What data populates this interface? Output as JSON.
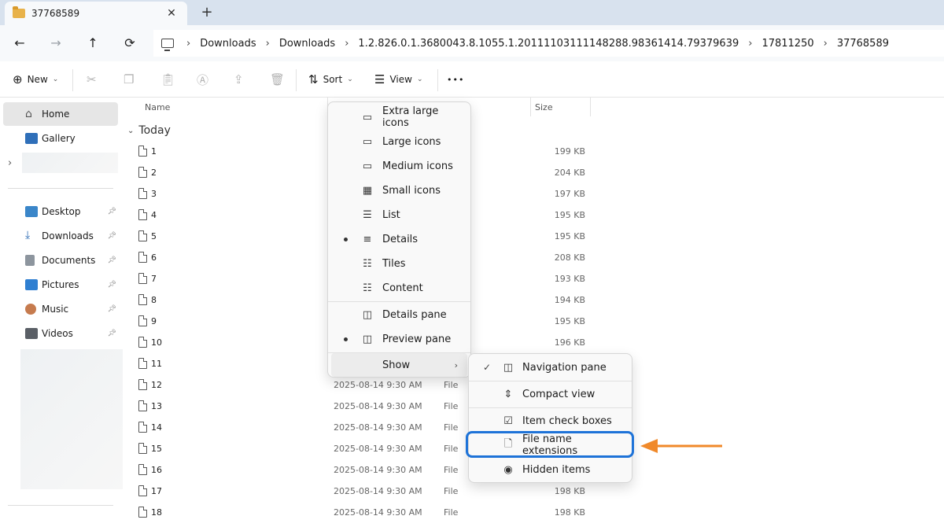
{
  "tab": {
    "title": "37768589",
    "close": "✕",
    "new": "+"
  },
  "nav": {
    "back": "←",
    "forward": "→",
    "up": "↑",
    "refresh": "⟳"
  },
  "breadcrumb": [
    "Downloads",
    "Downloads",
    "1.2.826.0.1.3680043.8.1055.1.20111103111148288.98361414.79379639",
    "17811250",
    "37768589"
  ],
  "breadcrumb_sep": "›",
  "toolbar": {
    "new_label": "New",
    "sort_label": "Sort",
    "view_label": "View",
    "more": "•••"
  },
  "sidebar": {
    "home": "Home",
    "gallery": "Gallery",
    "expand": "›",
    "pinned": [
      "Desktop",
      "Downloads",
      "Documents",
      "Pictures",
      "Music",
      "Videos"
    ]
  },
  "columns": {
    "name": "Name",
    "size": "Size"
  },
  "group": {
    "label": "Today"
  },
  "files": [
    {
      "name": "1",
      "date": "",
      "type": "",
      "size": "199 KB"
    },
    {
      "name": "2",
      "date": "",
      "type": "",
      "size": "204 KB"
    },
    {
      "name": "3",
      "date": "",
      "type": "",
      "size": "197 KB"
    },
    {
      "name": "4",
      "date": "",
      "type": "",
      "size": "195 KB"
    },
    {
      "name": "5",
      "date": "",
      "type": "",
      "size": "195 KB"
    },
    {
      "name": "6",
      "date": "",
      "type": "",
      "size": "208 KB"
    },
    {
      "name": "7",
      "date": "",
      "type": "",
      "size": "193 KB"
    },
    {
      "name": "8",
      "date": "",
      "type": "",
      "size": "194 KB"
    },
    {
      "name": "9",
      "date": "",
      "type": "",
      "size": "195 KB"
    },
    {
      "name": "10",
      "date": "",
      "type": "",
      "size": "196 KB"
    },
    {
      "name": "11",
      "date": "",
      "type": "",
      "size": ""
    },
    {
      "name": "12",
      "date": "2025-08-14 9:30 AM",
      "type": "File",
      "size": ""
    },
    {
      "name": "13",
      "date": "2025-08-14 9:30 AM",
      "type": "File",
      "size": ""
    },
    {
      "name": "14",
      "date": "2025-08-14 9:30 AM",
      "type": "File",
      "size": ""
    },
    {
      "name": "15",
      "date": "2025-08-14 9:30 AM",
      "type": "File",
      "size": ""
    },
    {
      "name": "16",
      "date": "2025-08-14 9:30 AM",
      "type": "File",
      "size": ""
    },
    {
      "name": "17",
      "date": "2025-08-14 9:30 AM",
      "type": "File",
      "size": "198 KB"
    },
    {
      "name": "18",
      "date": "2025-08-14 9:30 AM",
      "type": "File",
      "size": "198 KB"
    }
  ],
  "view_menu": {
    "items": [
      {
        "label": "Extra large icons",
        "icon": "▭",
        "selected": false
      },
      {
        "label": "Large icons",
        "icon": "▭",
        "selected": false
      },
      {
        "label": "Medium icons",
        "icon": "▭",
        "selected": false
      },
      {
        "label": "Small icons",
        "icon": "▦",
        "selected": false
      },
      {
        "label": "List",
        "icon": "☰",
        "selected": false
      },
      {
        "label": "Details",
        "icon": "≡",
        "selected": true
      },
      {
        "label": "Tiles",
        "icon": "☷",
        "selected": false
      },
      {
        "label": "Content",
        "icon": "☷",
        "selected": false
      }
    ],
    "panes": [
      {
        "label": "Details pane",
        "icon": "◫",
        "selected": false
      },
      {
        "label": "Preview pane",
        "icon": "◫",
        "selected": true
      }
    ],
    "show_label": "Show",
    "show_arrow": "›"
  },
  "show_menu": {
    "items": [
      {
        "label": "Navigation pane",
        "icon": "◫",
        "checked": true
      },
      {
        "label": "Compact view",
        "icon": "⇕",
        "checked": false
      },
      {
        "label": "Item check boxes",
        "icon": "☑",
        "checked": false
      },
      {
        "label": "File name extensions",
        "icon": "🗋",
        "checked": false
      },
      {
        "label": "Hidden items",
        "icon": "◉",
        "checked": false
      }
    ],
    "check_mark": "✓"
  },
  "colors": {
    "highlight": "#1e73d8",
    "arrow": "#f0892a"
  }
}
